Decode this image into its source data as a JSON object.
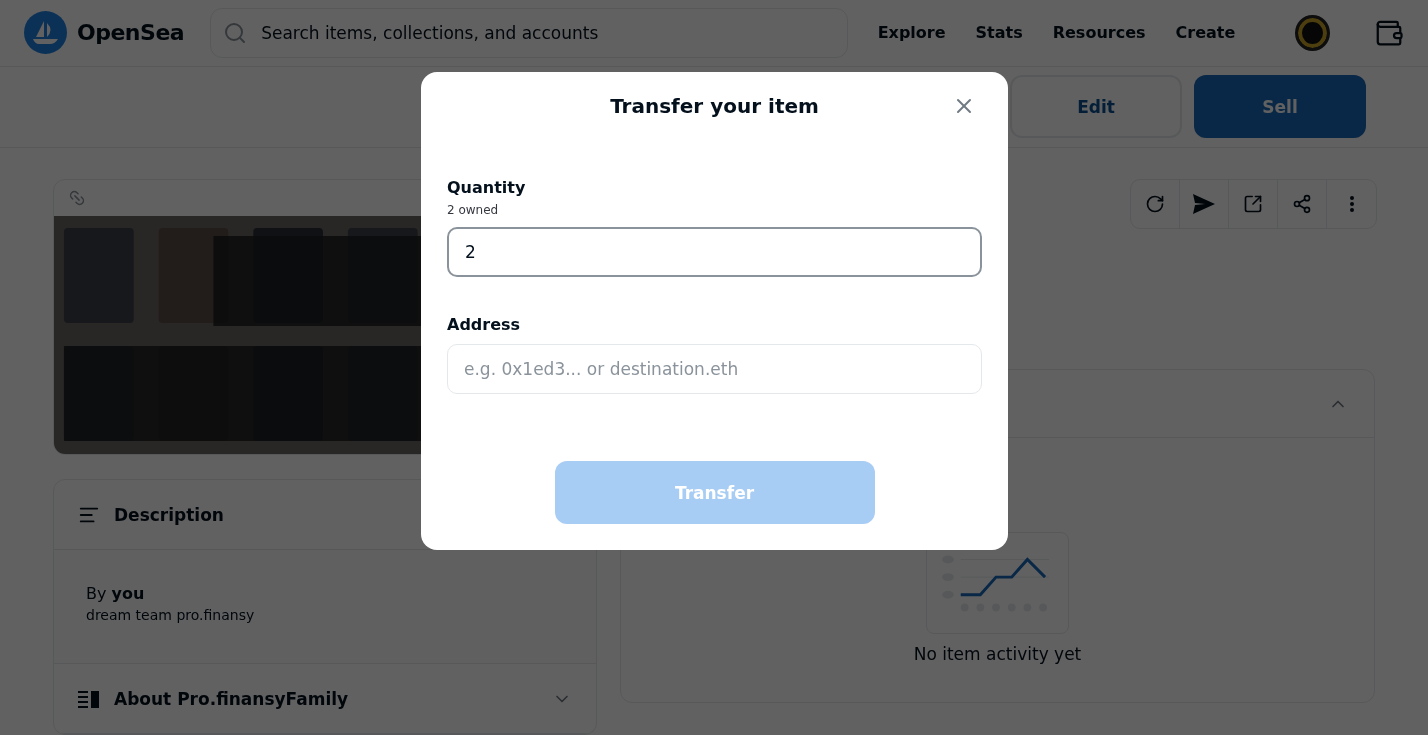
{
  "header": {
    "logo": "OpenSea",
    "search": {
      "placeholder": "Search items, collections, and accounts"
    },
    "nav": [
      "Explore",
      "Stats",
      "Resources",
      "Create"
    ]
  },
  "toolbar": {
    "buttons": [
      {
        "label": "Edit",
        "kind": "secondary"
      },
      {
        "label": "Sell",
        "kind": "primary"
      }
    ]
  },
  "description": {
    "title": "Description",
    "byline": "By **you**",
    "text": "dream team pro.finansy"
  },
  "about": {
    "title": "About Pro.finansyFamily",
    "expanded": false
  },
  "activity": {
    "expanded": true,
    "empty_text": "No item activity yet"
  },
  "modal": {
    "title": "Transfer your item",
    "quantity": {
      "label": "Quantity",
      "hint": "2 owned",
      "value": "2"
    },
    "address": {
      "label": "Address",
      "placeholder": "e.g. 0x1ed3... or destination.eth"
    },
    "submit": {
      "label": "Transfer",
      "disabled": true
    }
  }
}
